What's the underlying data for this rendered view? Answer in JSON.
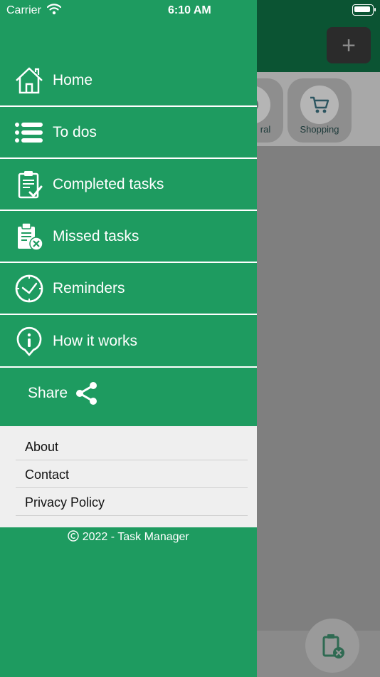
{
  "status_bar": {
    "carrier": "Carrier",
    "time": "6:10 AM"
  },
  "background": {
    "add_symbol": "+",
    "categories": [
      {
        "label": "ral",
        "icon": "gear-icon"
      },
      {
        "label": "Shopping",
        "icon": "cart-icon"
      }
    ]
  },
  "menu": {
    "items": [
      {
        "label": "Home",
        "icon": "home-icon"
      },
      {
        "label": "To dos",
        "icon": "list-icon"
      },
      {
        "label": "Completed tasks",
        "icon": "clipboard-check-icon"
      },
      {
        "label": "Missed tasks",
        "icon": "clipboard-x-icon"
      },
      {
        "label": "Reminders",
        "icon": "clock-icon"
      },
      {
        "label": "How it works",
        "icon": "info-icon"
      }
    ],
    "share_label": "Share"
  },
  "links": [
    "About",
    "Contact",
    "Privacy Policy"
  ],
  "footer": {
    "copyright": "2022 - Task Manager"
  },
  "colors": {
    "drawer": "#1e9b60",
    "header": "#0b5433",
    "links_bg": "#efefef"
  }
}
